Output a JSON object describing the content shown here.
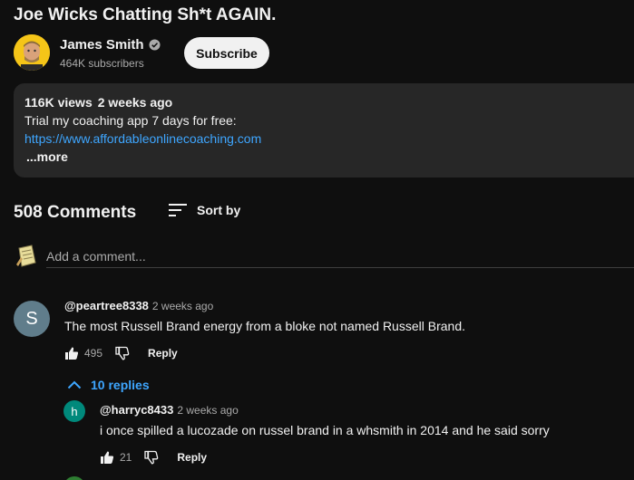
{
  "video": {
    "title": "Joe Wicks Chatting Sh*t AGAIN."
  },
  "channel": {
    "name": "James Smith",
    "subscribers": "464K subscribers",
    "subscribe_label": "Subscribe"
  },
  "description": {
    "views": "116K views",
    "date": "2 weeks ago",
    "text": "Trial my coaching app 7 days for free:",
    "link": "https://www.affordableonlinecoaching.com",
    "more": "...more"
  },
  "comments_section": {
    "count": "508 Comments",
    "sort_label": "Sort by",
    "add_placeholder": "Add a comment..."
  },
  "comments": [
    {
      "avatar_letter": "S",
      "avatar_color": "#607d8b",
      "author": "@peartree8338",
      "time": "2 weeks ago",
      "text": "The most Russell Brand energy from a bloke not named Russell Brand.",
      "likes": "495",
      "reply_label": "Reply"
    }
  ],
  "replies_toggle": "10 replies",
  "replies": [
    {
      "avatar_letter": "h",
      "avatar_color": "#00897b",
      "author": "@harryc8433",
      "time": "2 weeks ago",
      "text": "i once spilled a lucozade on russel brand in a whsmith in 2014 and he said sorry",
      "likes": "21",
      "reply_label": "Reply"
    }
  ],
  "colors": {
    "background": "#0f0f0f",
    "link": "#3ea6ff",
    "panel": "#272727"
  },
  "icons": [
    "verified-icon",
    "sort-icon",
    "thumb-up-icon",
    "thumb-down-icon",
    "chevron-up-icon"
  ]
}
